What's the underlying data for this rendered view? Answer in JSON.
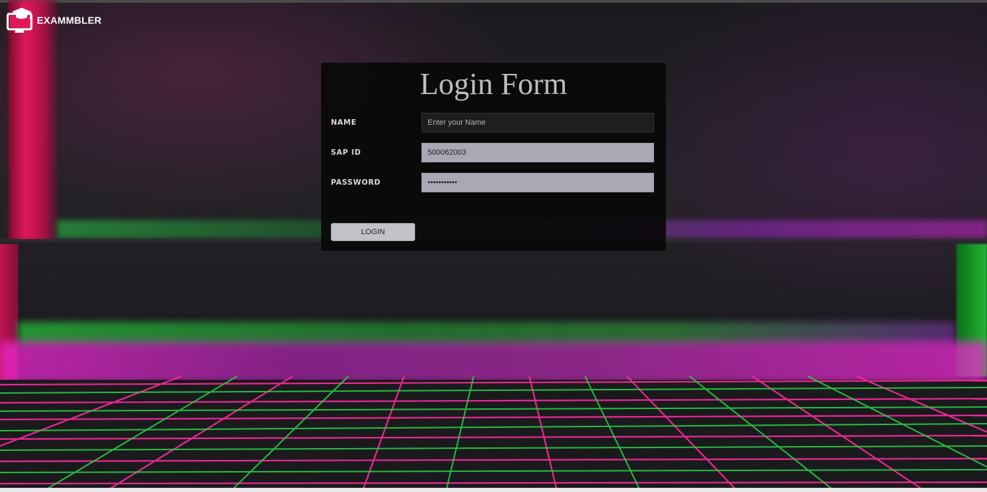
{
  "brand": {
    "name": "EXAMMBLER",
    "logo_icon": "monitor-graduation-cap-icon",
    "accent_color": "#e0185a"
  },
  "form": {
    "title": "Login Form",
    "fields": {
      "name": {
        "label": "NAME",
        "placeholder": "Enter your Name",
        "value": ""
      },
      "sap_id": {
        "label": "SAP ID",
        "placeholder": "",
        "value": "500062003"
      },
      "password": {
        "label": "PASSWORD",
        "placeholder": "",
        "value": "•••••••••••"
      }
    },
    "submit_label": "LOGIN"
  },
  "colors": {
    "card_background": "#080808",
    "filled_input_background": "#a8a9b5",
    "button_background": "#c2c2c6",
    "grid_pink": "#ff2aa0",
    "grid_green": "#2bd64a"
  }
}
